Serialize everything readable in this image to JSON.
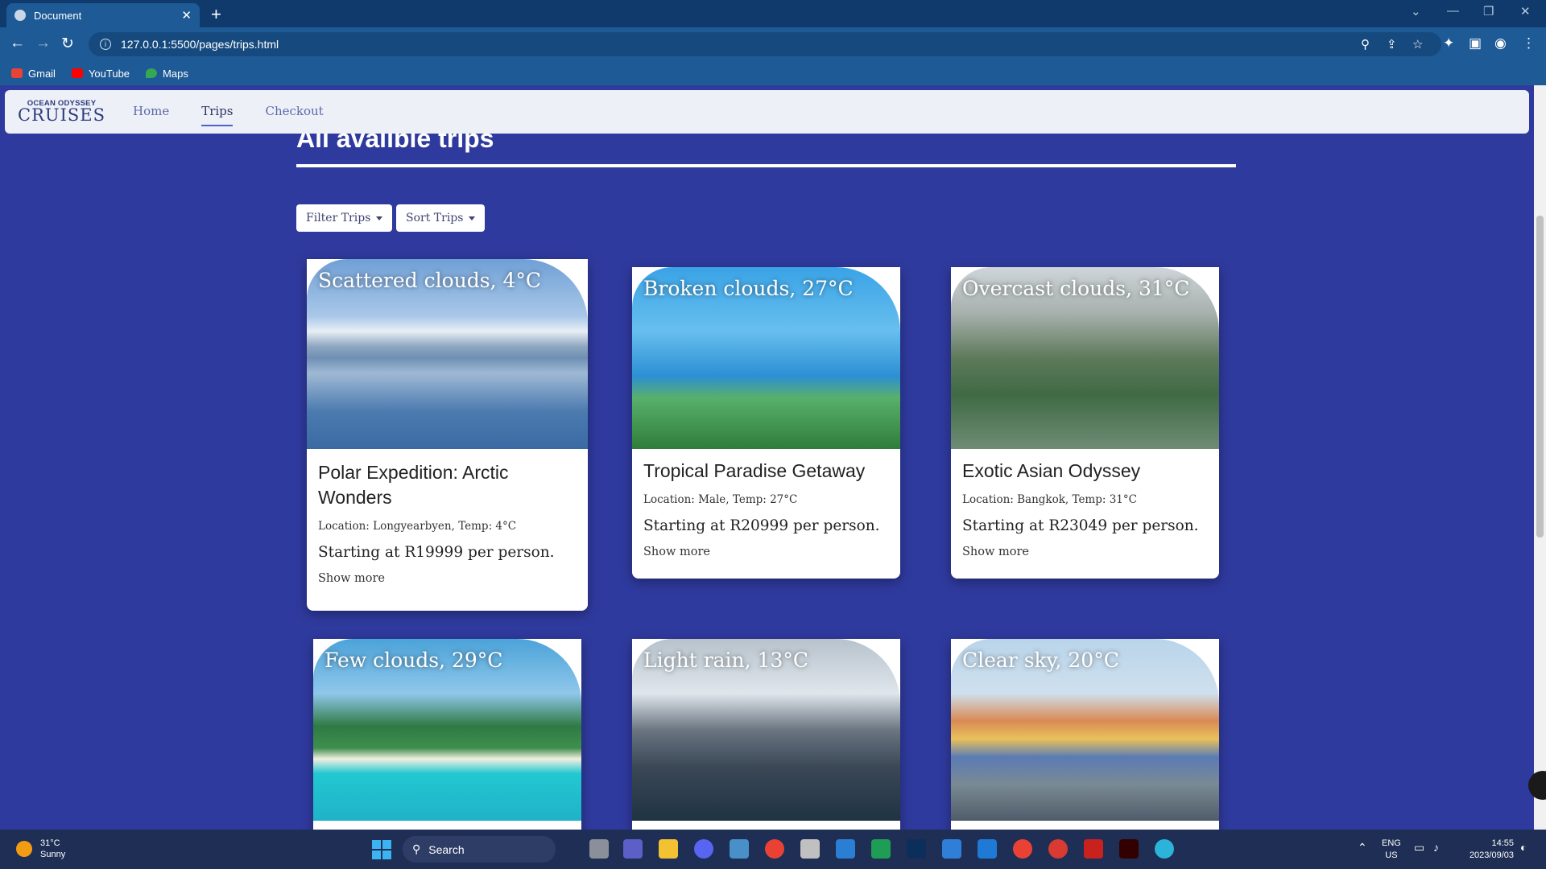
{
  "browser": {
    "tab_title": "Document",
    "tab_close": "✕",
    "new_tab": "+",
    "url": "127.0.0.1:5500/pages/trips.html",
    "bookmarks": [
      {
        "label": "Gmail",
        "color": "#ea4335"
      },
      {
        "label": "YouTube",
        "color": "#ff0000"
      },
      {
        "label": "Maps",
        "color": "#34a853"
      }
    ]
  },
  "site": {
    "logo_line1": "OCEAN ODYSSEY",
    "logo_line2": "CRUISES",
    "nav": [
      {
        "label": "Home",
        "active": false
      },
      {
        "label": "Trips",
        "active": true
      },
      {
        "label": "Checkout",
        "active": false
      }
    ],
    "page_title": "All availble trips",
    "filter_label": "Filter Trips",
    "sort_label": "Sort Trips"
  },
  "trips": [
    {
      "weather": "Scattered clouds, 4°C",
      "title": "Polar Expedition: Arctic Wonders",
      "location": "Location: Longyearbyen, Temp: 4°C",
      "price": "Starting at R19999 per person.",
      "more": "Show more"
    },
    {
      "weather": "Broken clouds, 27°C",
      "title": "Tropical Paradise Getaway",
      "location": "Location: Male, Temp: 27°C",
      "price": "Starting at R20999 per person.",
      "more": "Show more"
    },
    {
      "weather": "Overcast clouds, 31°C",
      "title": "Exotic Asian Odyssey",
      "location": "Location: Bangkok, Temp: 31°C",
      "price": "Starting at R23049 per person.",
      "more": "Show more"
    },
    {
      "weather": "Few clouds, 29°C"
    },
    {
      "weather": "Light rain, 13°C"
    },
    {
      "weather": "Clear sky, 20°C"
    }
  ],
  "taskbar": {
    "weather_temp": "31°C",
    "weather_cond": "Sunny",
    "search_label": "Search",
    "lang_line1": "ENG",
    "lang_line2": "US",
    "time": "14:55",
    "date": "2023/09/03"
  }
}
